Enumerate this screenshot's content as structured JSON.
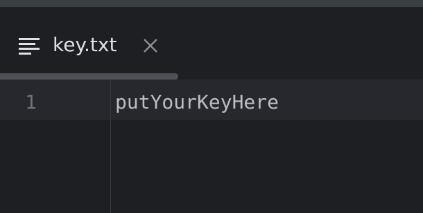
{
  "tab": {
    "icon": "text-lines-icon",
    "label": "key.txt",
    "close_icon": "close-icon"
  },
  "editor": {
    "lines": [
      {
        "number": "1",
        "text": "putYourKeyHere"
      }
    ]
  },
  "colors": {
    "background": "#1e1f22",
    "current_line": "#26282e",
    "text": "#bcbec4",
    "line_number": "#6f737a"
  }
}
